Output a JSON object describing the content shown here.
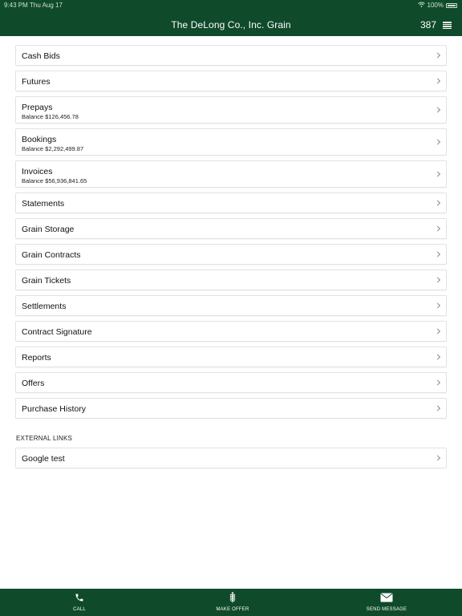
{
  "status_bar": {
    "time": "9:43 PM",
    "date": "Thu Aug 17",
    "battery": "100%"
  },
  "header": {
    "title": "The DeLong Co., Inc. Grain",
    "count": "387"
  },
  "menu": [
    {
      "label": "Cash Bids"
    },
    {
      "label": "Futures"
    },
    {
      "label": "Prepays",
      "sub": "Balance $126,456.78"
    },
    {
      "label": "Bookings",
      "sub": "Balance $2,292,499.87"
    },
    {
      "label": "Invoices",
      "sub": "Balance $56,936,841.65"
    },
    {
      "label": "Statements"
    },
    {
      "label": "Grain Storage"
    },
    {
      "label": "Grain Contracts"
    },
    {
      "label": "Grain Tickets"
    },
    {
      "label": "Settlements"
    },
    {
      "label": "Contract Signature"
    },
    {
      "label": "Reports"
    },
    {
      "label": "Offers"
    },
    {
      "label": "Purchase History"
    }
  ],
  "external_links": {
    "header": "EXTERNAL LINKS",
    "items": [
      {
        "label": "Google test"
      }
    ]
  },
  "tabs": {
    "call": "CALL",
    "make_offer": "MAKE OFFER",
    "send_message": "SEND MESSAGE"
  },
  "colors": {
    "brand_green": "#0f4a2b"
  }
}
